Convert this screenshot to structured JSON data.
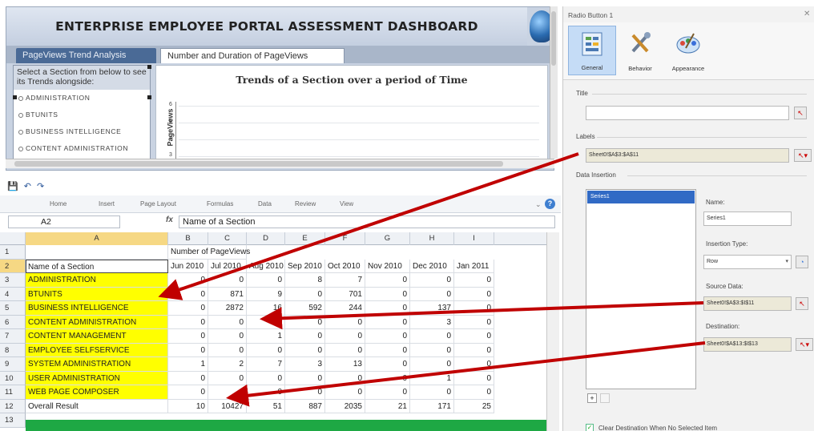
{
  "dashboard": {
    "title": "ENTERPRISE EMPLOYEE PORTAL ASSESSMENT DASHBOARD",
    "tabs": [
      "PageViews Trend Analysis",
      "Number and Duration of PageViews"
    ],
    "section_header": "Select a Section from below to see its Trends alongside:",
    "sections": [
      "ADMINISTRATION",
      "BTUNITS",
      "BUSINESS INTELLIGENCE",
      "CONTENT ADMINISTRATION"
    ],
    "chart_title": "Trends of a Section over a period of Time",
    "y_axis_label": "PageViews",
    "y_ticks": [
      "6",
      "5",
      "4",
      "3"
    ]
  },
  "excel": {
    "ribbon_tabs": [
      "Home",
      "Insert",
      "Page Layout",
      "Formulas",
      "Data",
      "Review",
      "View"
    ],
    "name_box": "A2",
    "fx": "fx",
    "formula": "Name of a Section",
    "columns": [
      "A",
      "B",
      "C",
      "D",
      "E",
      "F",
      "G",
      "H",
      "I"
    ],
    "row_numbers": [
      "1",
      "2",
      "3",
      "4",
      "5",
      "6",
      "7",
      "8",
      "9",
      "10",
      "11",
      "12",
      "13"
    ],
    "header_row1_label": "Number of PageViews",
    "header_row": [
      "Name of a Section",
      "Jun 2010",
      "Jul 2010",
      "Aug 2010",
      "Sep 2010",
      "Oct 2010",
      "Nov 2010",
      "Dec 2010",
      "Jan 2011"
    ],
    "data_rows": [
      {
        "name": "ADMINISTRATION",
        "values": [
          "0",
          "0",
          "0",
          "8",
          "7",
          "0",
          "0",
          "0"
        ]
      },
      {
        "name": "BTUNITS",
        "values": [
          "0",
          "871",
          "9",
          "0",
          "701",
          "0",
          "0",
          "0"
        ]
      },
      {
        "name": "BUSINESS INTELLIGENCE",
        "values": [
          "0",
          "2872",
          "16",
          "592",
          "244",
          "0",
          "137",
          "0"
        ]
      },
      {
        "name": "CONTENT ADMINISTRATION",
        "values": [
          "0",
          "0",
          "0",
          "0",
          "0",
          "0",
          "3",
          "0"
        ]
      },
      {
        "name": "CONTENT MANAGEMENT",
        "values": [
          "0",
          "0",
          "1",
          "0",
          "0",
          "0",
          "0",
          "0"
        ]
      },
      {
        "name": "EMPLOYEE SELFSERVICE",
        "values": [
          "0",
          "0",
          "0",
          "0",
          "0",
          "0",
          "0",
          "0"
        ]
      },
      {
        "name": "SYSTEM ADMINISTRATION",
        "values": [
          "1",
          "2",
          "7",
          "3",
          "13",
          "0",
          "0",
          "0"
        ]
      },
      {
        "name": "USER ADMINISTRATION",
        "values": [
          "0",
          "0",
          "0",
          "0",
          "0",
          "0",
          "1",
          "0"
        ]
      },
      {
        "name": "WEB PAGE COMPOSER",
        "values": [
          "0",
          "0",
          "0",
          "0",
          "0",
          "0",
          "0",
          "0"
        ]
      }
    ],
    "total_row": {
      "name": "Overall Result",
      "values": [
        "10",
        "10427",
        "51",
        "887",
        "2035",
        "21",
        "171",
        "25"
      ]
    }
  },
  "props": {
    "title": "Radio Button 1",
    "ribbon": [
      "General",
      "Behavior",
      "Appearance"
    ],
    "title_label": "Title",
    "labels_label": "Labels",
    "labels_value": "Sheet0!$A$3:$A$11",
    "data_insertion_label": "Data Insertion",
    "series_item": "Series1",
    "name_label": "Name:",
    "name_value": "Series1",
    "insertion_type_label": "Insertion Type:",
    "insertion_type_value": "Row",
    "source_data_label": "Source Data:",
    "source_data_value": "Sheet0!$A$3:$I$11",
    "destination_label": "Destination:",
    "destination_value": "Sheet0!$A$13:$I$13",
    "clear_label": "Clear Destination When No Selected Item"
  },
  "colors": {
    "highlight": "#ffff00",
    "arrow": "#c00000",
    "selected": "#316ac5",
    "green_row": "#1ea844"
  }
}
